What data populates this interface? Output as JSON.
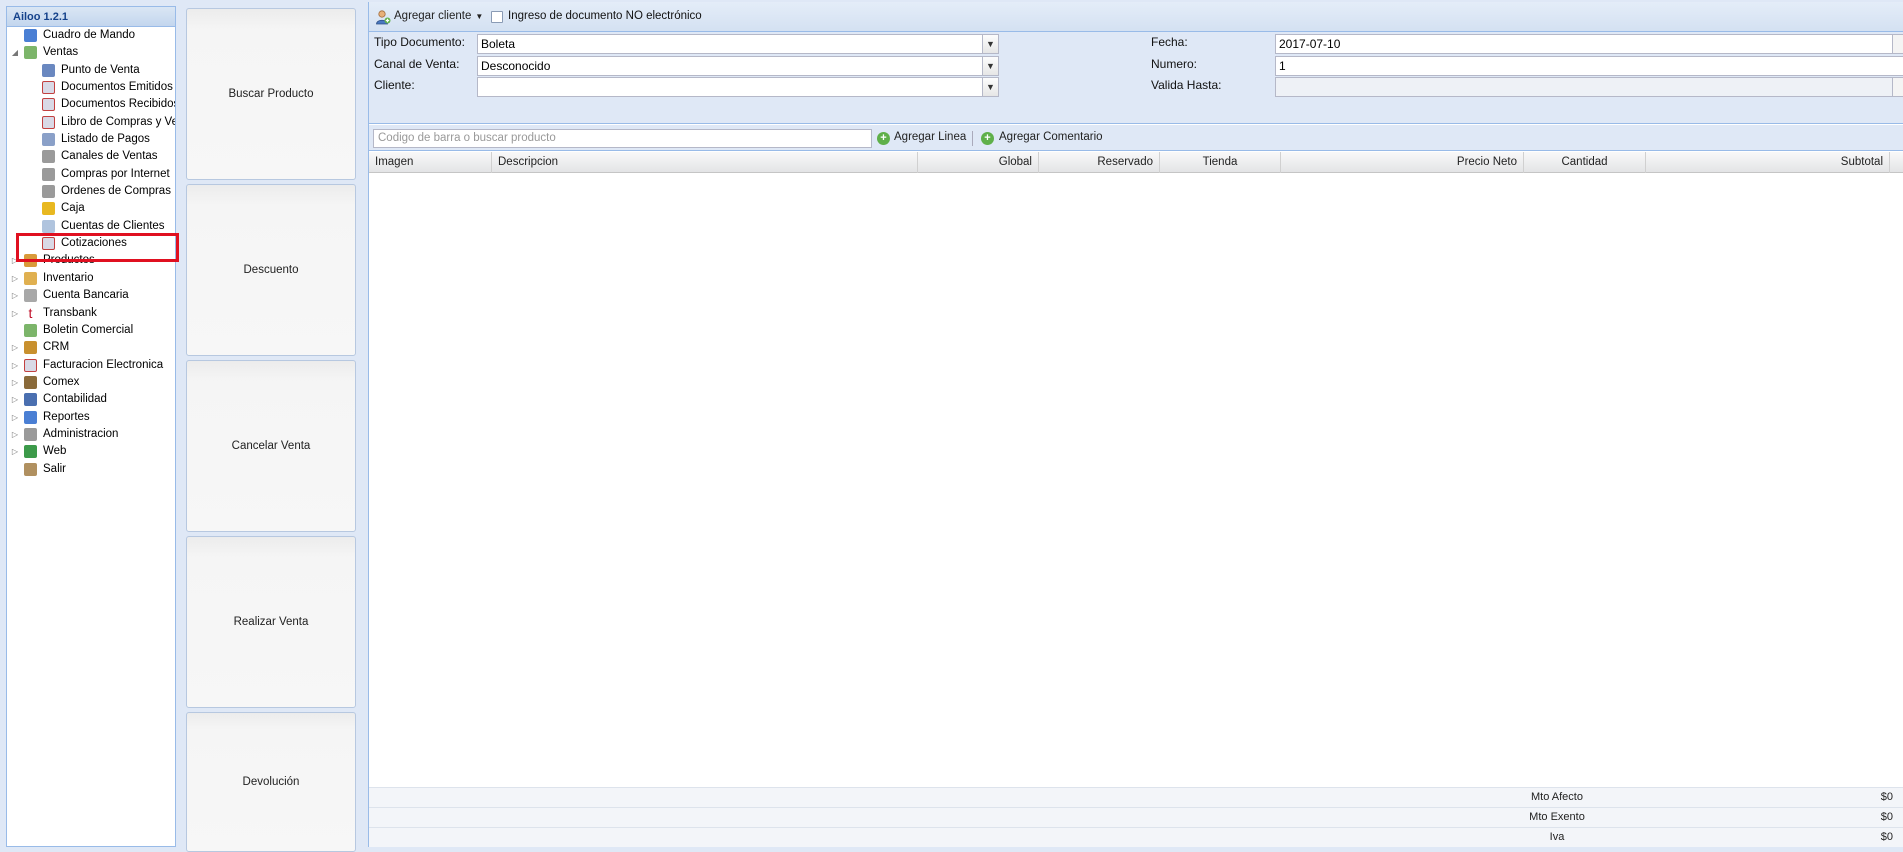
{
  "nav": {
    "title": "Ailoo 1.2.1",
    "items": [
      {
        "label": "Cuadro de Mando",
        "icon": "bar-chart-icon",
        "level": 0,
        "expander": ""
      },
      {
        "label": "Ventas",
        "icon": "tag-icon",
        "level": 0,
        "expander": "expanded"
      },
      {
        "label": "Punto de Venta",
        "icon": "pos-terminal-icon",
        "level": 1
      },
      {
        "label": "Documentos Emitidos",
        "icon": "document-icon",
        "level": 1
      },
      {
        "label": "Documentos Recibidos",
        "icon": "document-icon",
        "level": 1
      },
      {
        "label": "Libro de Compras y Ventas",
        "icon": "document-icon",
        "level": 1
      },
      {
        "label": "Listado de Pagos",
        "icon": "calculator-icon",
        "level": 1
      },
      {
        "label": "Canales de Ventas",
        "icon": "shopping-cart-icon",
        "level": 1
      },
      {
        "label": "Compras por Internet",
        "icon": "shopping-cart-icon",
        "level": 1
      },
      {
        "label": "Ordenes de Compras",
        "icon": "shopping-cart-icon",
        "level": 1
      },
      {
        "label": "Caja",
        "icon": "coins-icon",
        "level": 1,
        "highlighted": true
      },
      {
        "label": "Cuentas de Clientes",
        "icon": "account-card-icon",
        "level": 1
      },
      {
        "label": "Cotizaciones",
        "icon": "document-icon",
        "level": 1
      },
      {
        "label": "Productos",
        "icon": "box-icon",
        "level": 0,
        "expander": "collapsed"
      },
      {
        "label": "Inventario",
        "icon": "package-icon",
        "level": 0,
        "expander": "collapsed"
      },
      {
        "label": "Cuenta Bancaria",
        "icon": "bank-icon",
        "level": 0,
        "expander": "collapsed"
      },
      {
        "label": "Transbank",
        "icon": "transbank-icon",
        "level": 0,
        "expander": "collapsed"
      },
      {
        "label": "Boletin Comercial",
        "icon": "tag-icon",
        "level": 0,
        "expander": ""
      },
      {
        "label": "CRM",
        "icon": "users-icon",
        "level": 0,
        "expander": "collapsed"
      },
      {
        "label": "Facturacion Electronica",
        "icon": "document-icon",
        "level": 0,
        "expander": "collapsed"
      },
      {
        "label": "Comex",
        "icon": "truck-icon",
        "level": 0,
        "expander": "collapsed"
      },
      {
        "label": "Contabilidad",
        "icon": "ledger-icon",
        "level": 0,
        "expander": "collapsed"
      },
      {
        "label": "Reportes",
        "icon": "bar-chart-icon",
        "level": 0,
        "expander": "collapsed"
      },
      {
        "label": "Administracion",
        "icon": "gear-icon",
        "level": 0,
        "expander": "collapsed"
      },
      {
        "label": "Web",
        "icon": "globe-icon",
        "level": 0,
        "expander": "collapsed"
      },
      {
        "label": "Salir",
        "icon": "door-icon",
        "level": 0,
        "expander": ""
      }
    ]
  },
  "actions": {
    "buscar_producto": "Buscar Producto",
    "descuento": "Descuento",
    "cancelar_venta": "Cancelar Venta",
    "realizar_venta": "Realizar Venta",
    "devolucion": "Devolución"
  },
  "toolbar": {
    "agregar_cliente": "Agregar cliente",
    "no_electronico_label": "Ingreso de documento NO electrónico",
    "no_electronico_checked": false
  },
  "form": {
    "tipo_documento_label": "Tipo Documento:",
    "tipo_documento_value": "Boleta",
    "canal_venta_label": "Canal de Venta:",
    "canal_venta_value": "Desconocido",
    "cliente_label": "Cliente:",
    "cliente_value": "",
    "fecha_label": "Fecha:",
    "fecha_value": "2017-07-10",
    "numero_label": "Numero:",
    "numero_value": "1",
    "valida_hasta_label": "Valida Hasta:",
    "valida_hasta_value": ""
  },
  "search": {
    "placeholder": "Codigo de barra o buscar producto",
    "agregar_linea": "Agregar Linea",
    "agregar_comentario": "Agregar Comentario"
  },
  "grid": {
    "columns": [
      "Imagen",
      "Descripcion",
      "Global",
      "Reservado",
      "Tienda",
      "Precio Neto",
      "Cantidad",
      "Subtotal"
    ],
    "rows": []
  },
  "totals": [
    {
      "label": "Mto Afecto",
      "value": "$0"
    },
    {
      "label": "Mto Exento",
      "value": "$0"
    },
    {
      "label": "Iva",
      "value": "$0"
    }
  ],
  "colors": {
    "highlight": "#e01020",
    "panel_border": "#99bbe8",
    "panel_bg": "#dfe8f6"
  }
}
